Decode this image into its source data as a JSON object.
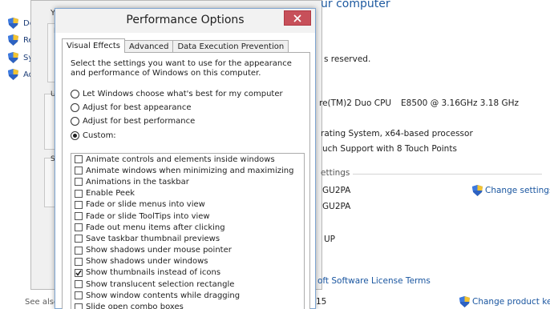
{
  "background_nav": {
    "items": [
      {
        "label": "De"
      },
      {
        "label": "Re"
      },
      {
        "label": "Sy"
      },
      {
        "label": "Ad"
      }
    ],
    "see_also": "See also"
  },
  "system_window": {
    "title_fragment": "Y",
    "edge_labels": [
      "P",
      "U",
      "S"
    ]
  },
  "system_info": {
    "title": "ur computer",
    "copyright": "s reserved.",
    "processor_label": "re(TM)2 Duo CPU",
    "processor_model": "E8500  @ 3.16GHz   3.18 GHz",
    "system_type": "rating System, x64-based processor",
    "pen_touch": "uch Support with 8 Touch Points",
    "section_settings": "ettings",
    "computer_name": "GU2PA",
    "full_name": "GU2PA",
    "workgroup": "UP",
    "change_settings": "Change settings",
    "license_terms": "oft Software License Terms",
    "change_product_key": "Change product key",
    "bottom_fragment": "15"
  },
  "dialog": {
    "title": "Performance Options",
    "tabs": [
      {
        "label": "Visual Effects",
        "active": true
      },
      {
        "label": "Advanced",
        "active": false
      },
      {
        "label": "Data Execution Prevention",
        "active": false
      }
    ],
    "description": "Select the settings you want to use for the appearance and performance of Windows on this computer.",
    "radios": [
      {
        "label": "Let Windows choose what's best for my computer",
        "checked": false
      },
      {
        "label": "Adjust for best appearance",
        "checked": false
      },
      {
        "label": "Adjust for best performance",
        "checked": false
      },
      {
        "label": "Custom:",
        "checked": true
      }
    ],
    "options": [
      {
        "label": "Animate controls and elements inside windows",
        "checked": false
      },
      {
        "label": "Animate windows when minimizing and maximizing",
        "checked": false
      },
      {
        "label": "Animations in the taskbar",
        "checked": false
      },
      {
        "label": "Enable Peek",
        "checked": false
      },
      {
        "label": "Fade or slide menus into view",
        "checked": false
      },
      {
        "label": "Fade or slide ToolTips into view",
        "checked": false
      },
      {
        "label": "Fade out menu items after clicking",
        "checked": false
      },
      {
        "label": "Save taskbar thumbnail previews",
        "checked": false
      },
      {
        "label": "Show shadows under mouse pointer",
        "checked": false
      },
      {
        "label": "Show shadows under windows",
        "checked": false
      },
      {
        "label": "Show thumbnails instead of icons",
        "checked": true
      },
      {
        "label": "Show translucent selection rectangle",
        "checked": false
      },
      {
        "label": "Show window contents while dragging",
        "checked": false
      },
      {
        "label": "Slide open combo boxes",
        "checked": false
      }
    ]
  }
}
